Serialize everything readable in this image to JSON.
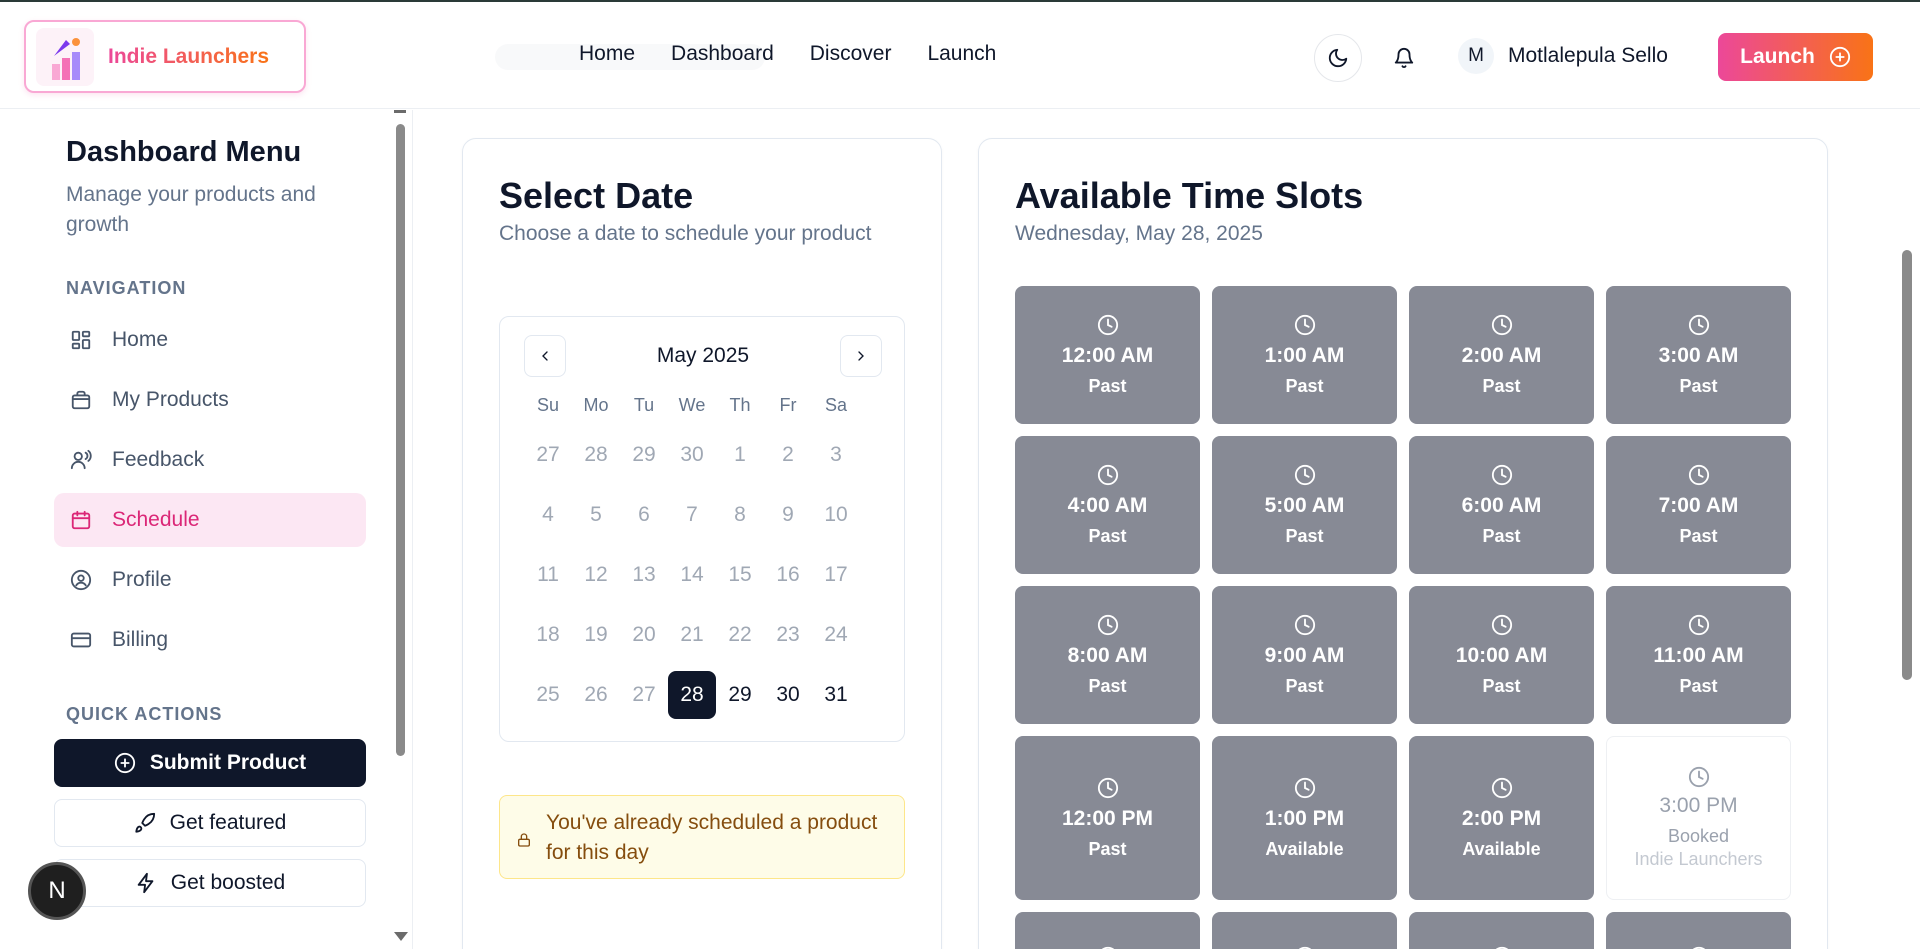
{
  "header": {
    "brand": "Indie Launchers",
    "nav": [
      "Home",
      "Dashboard",
      "Discover",
      "Launch"
    ],
    "user_initial": "M",
    "user_name": "Motlalepula Sello",
    "launch_label": "Launch"
  },
  "sidebar": {
    "title": "Dashboard Menu",
    "subtitle": "Manage your products and growth",
    "nav_heading": "NAVIGATION",
    "items": [
      {
        "label": "Home",
        "icon": "grid-icon"
      },
      {
        "label": "My Products",
        "icon": "bag-icon"
      },
      {
        "label": "Feedback",
        "icon": "user-voice-icon"
      },
      {
        "label": "Schedule",
        "icon": "calendar-icon",
        "active": true
      },
      {
        "label": "Profile",
        "icon": "user-circle-icon"
      },
      {
        "label": "Billing",
        "icon": "credit-card-icon"
      }
    ],
    "qa_heading": "QUICK ACTIONS",
    "quick_actions": [
      {
        "label": "Submit Product",
        "icon": "plus-circle-icon"
      },
      {
        "label": "Get featured",
        "icon": "rocket-icon"
      },
      {
        "label": "Get boosted",
        "icon": "bolt-icon"
      }
    ],
    "badge": "N"
  },
  "calendar": {
    "title": "Select Date",
    "subtitle": "Choose a date to schedule your product",
    "month_label": "May 2025",
    "weekdays": [
      "Su",
      "Mo",
      "Tu",
      "We",
      "Th",
      "Fr",
      "Sa"
    ],
    "days": [
      "27",
      "28",
      "29",
      "30",
      "1",
      "2",
      "3",
      "4",
      "5",
      "6",
      "7",
      "8",
      "9",
      "10",
      "11",
      "12",
      "13",
      "14",
      "15",
      "16",
      "17",
      "18",
      "19",
      "20",
      "21",
      "22",
      "23",
      "24",
      "25",
      "26",
      "27",
      "28",
      "29",
      "30",
      "31"
    ],
    "selected_index": 31,
    "current_from_index": 31,
    "notice": "You've already scheduled a product for this day"
  },
  "slots": {
    "title": "Available Time Slots",
    "date_label": "Wednesday, May 28, 2025",
    "items": [
      {
        "time": "12:00 AM",
        "status": "Past"
      },
      {
        "time": "1:00 AM",
        "status": "Past"
      },
      {
        "time": "2:00 AM",
        "status": "Past"
      },
      {
        "time": "3:00 AM",
        "status": "Past"
      },
      {
        "time": "4:00 AM",
        "status": "Past"
      },
      {
        "time": "5:00 AM",
        "status": "Past"
      },
      {
        "time": "6:00 AM",
        "status": "Past"
      },
      {
        "time": "7:00 AM",
        "status": "Past"
      },
      {
        "time": "8:00 AM",
        "status": "Past"
      },
      {
        "time": "9:00 AM",
        "status": "Past"
      },
      {
        "time": "10:00 AM",
        "status": "Past"
      },
      {
        "time": "11:00 AM",
        "status": "Past"
      },
      {
        "time": "12:00 PM",
        "status": "Past"
      },
      {
        "time": "1:00 PM",
        "status": "Available"
      },
      {
        "time": "2:00 PM",
        "status": "Available"
      },
      {
        "time": "3:00 PM",
        "status": "Booked",
        "by": "Indie Launchers"
      }
    ]
  },
  "colors": {
    "accent_pink": "#ec4899",
    "accent_orange": "#f97316",
    "slot_gray": "#878a95",
    "dark": "#0f172a"
  }
}
